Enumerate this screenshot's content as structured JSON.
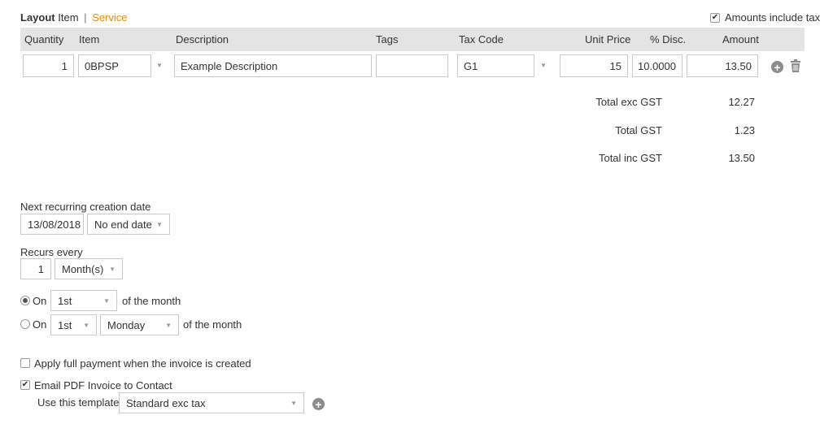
{
  "header": {
    "layout_label": "Layout",
    "item_label": "Item",
    "separator": "|",
    "service_label": "Service",
    "amounts_include_tax_label": "Amounts include tax",
    "amounts_include_tax_checked": true
  },
  "table": {
    "columns": [
      "Quantity",
      "Item",
      "Description",
      "Tags",
      "Tax Code",
      "Unit Price",
      "% Disc.",
      "Amount"
    ],
    "row": {
      "quantity": "1",
      "item": "0BPSP",
      "description": "Example Description",
      "tags": "",
      "tax_code": "G1",
      "unit_price": "15",
      "discount": "10.0000",
      "amount": "13.50"
    }
  },
  "totals": {
    "exc_gst_label": "Total exc GST",
    "exc_gst_value": "12.27",
    "gst_label": "Total GST",
    "gst_value": "1.23",
    "inc_gst_label": "Total inc GST",
    "inc_gst_value": "13.50"
  },
  "recurring": {
    "next_date_label": "Next recurring creation date",
    "next_date_value": "13/08/2018",
    "end_date_select": "No end date",
    "recurs_every_label": "Recurs every",
    "recurs_every_value": "1",
    "recurs_unit_select": "Month(s)",
    "option1": {
      "label": "On",
      "selected": true,
      "day_select": "1st",
      "suffix": "of the month"
    },
    "option2": {
      "label": "On",
      "selected": false,
      "ordinal_select": "1st",
      "weekday_select": "Monday",
      "suffix": "of the month"
    }
  },
  "options": {
    "apply_full_payment_label": "Apply full payment when the invoice is created",
    "apply_full_payment_checked": false,
    "email_pdf_label": "Email PDF Invoice to Contact",
    "email_pdf_checked": true,
    "template_label": "Use this template",
    "template_select": "Standard exc tax"
  },
  "icons": {
    "caret": "▼",
    "check": "✔",
    "plus": "+"
  }
}
